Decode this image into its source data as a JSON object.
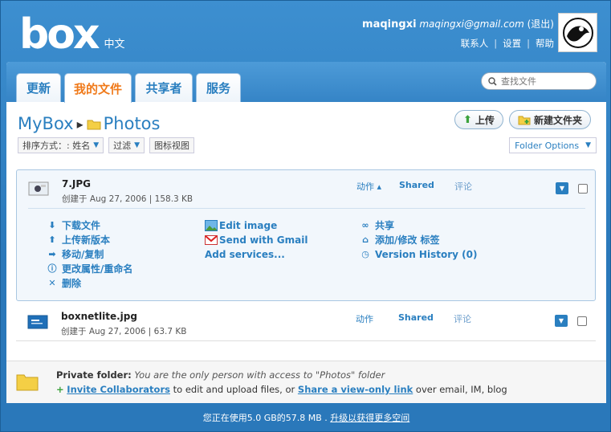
{
  "header": {
    "logo_text": "box",
    "language": "中文",
    "username": "maqingxi",
    "email": "maqingxi@gmail.com",
    "logout": "(退出)",
    "links": [
      "联系人",
      "设置",
      "帮助"
    ]
  },
  "tabs": [
    {
      "label": "更新"
    },
    {
      "label": "我的文件"
    },
    {
      "label": "共享者"
    },
    {
      "label": "服务"
    }
  ],
  "search": {
    "placeholder": "查找文件"
  },
  "breadcrumb": {
    "root": "MyBox",
    "folder": "Photos"
  },
  "buttons": {
    "upload": "上传",
    "new_folder": "新建文件夹"
  },
  "toolbar": {
    "sort_label": "排序方式：: 姓名",
    "filter": "过滤",
    "icon_view": "图标视图",
    "folder_options": "Folder Options"
  },
  "files": [
    {
      "name": "7.JPG",
      "meta": "创建于 Aug 27, 2006   |   158.3 KB",
      "action": "动作 ▴",
      "shared": "Shared",
      "comment": "评论"
    },
    {
      "name": "boxnetlite.jpg",
      "meta": "创建于 Aug 27, 2006   |   63.7 KB",
      "action": "动作",
      "shared": "Shared",
      "comment": "评论"
    }
  ],
  "file_actions": {
    "col1": [
      "下载文件",
      "上传新版本",
      "移动/复制",
      "更改属性/重命名",
      "删除"
    ],
    "col2": [
      "Edit image",
      "Send with Gmail",
      "Add services..."
    ],
    "col3": [
      "共享",
      "添加/修改 标签",
      "Version History (0)"
    ]
  },
  "private_folder": {
    "title": "Private folder:",
    "desc": "You are the only person with access to \"Photos\" folder",
    "invite": "Invite Collaborators",
    "mid": " to edit and upload files, or ",
    "share_link": "Share a view-only link",
    "tail": " over email, IM, blog"
  },
  "footer": {
    "usage": "您正在使用5.0 GB的57.8 MB .",
    "upgrade": "升级以获得更多空间"
  }
}
